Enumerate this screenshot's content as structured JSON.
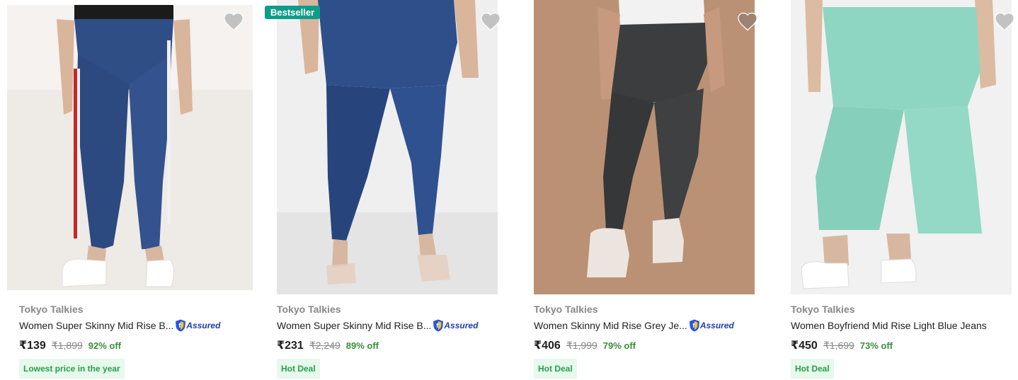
{
  "colors": {
    "price_green": "#388e3c",
    "deal_bg": "#e7f8ec",
    "deal_text": "#24a148",
    "bestseller_bg": "#0f9d8a",
    "wishlist_icon": "#c2c2c2",
    "assured_blue": "#1f3ea8"
  },
  "products": [
    {
      "brand": "Tokyo Talkies",
      "title": "Women Super Skinny Mid Rise B...",
      "assured": "Assured",
      "price": "₹139",
      "mrp": "₹1,899",
      "discount": "92% off",
      "deal": "Lowest price in the year",
      "image_icon": "dark-blue-skinny-jeans-side-stripe",
      "wishlist_icon": "heart-icon"
    },
    {
      "badge": "Bestseller",
      "brand": "Tokyo Talkies",
      "title": "Women Super Skinny Mid Rise B...",
      "assured": "Assured",
      "price": "₹231",
      "mrp": "₹2,249",
      "discount": "89% off",
      "deal": "Hot Deal",
      "image_icon": "blue-skinny-jeans",
      "wishlist_icon": "heart-icon"
    },
    {
      "brand": "Tokyo Talkies",
      "title": "Women Skinny Mid Rise Grey Je...",
      "assured": "Assured",
      "price": "₹406",
      "mrp": "₹1,999",
      "discount": "79% off",
      "deal": "Hot Deal",
      "image_icon": "grey-skinny-jeans",
      "wishlist_icon": "heart-icon"
    },
    {
      "brand": "Tokyo Talkies",
      "title": "Women Boyfriend Mid Rise Light Blue Jeans",
      "price": "₹450",
      "mrp": "₹1,699",
      "discount": "73% off",
      "deal": "Hot Deal",
      "image_icon": "mint-boyfriend-jeans",
      "wishlist_icon": "heart-icon"
    }
  ]
}
